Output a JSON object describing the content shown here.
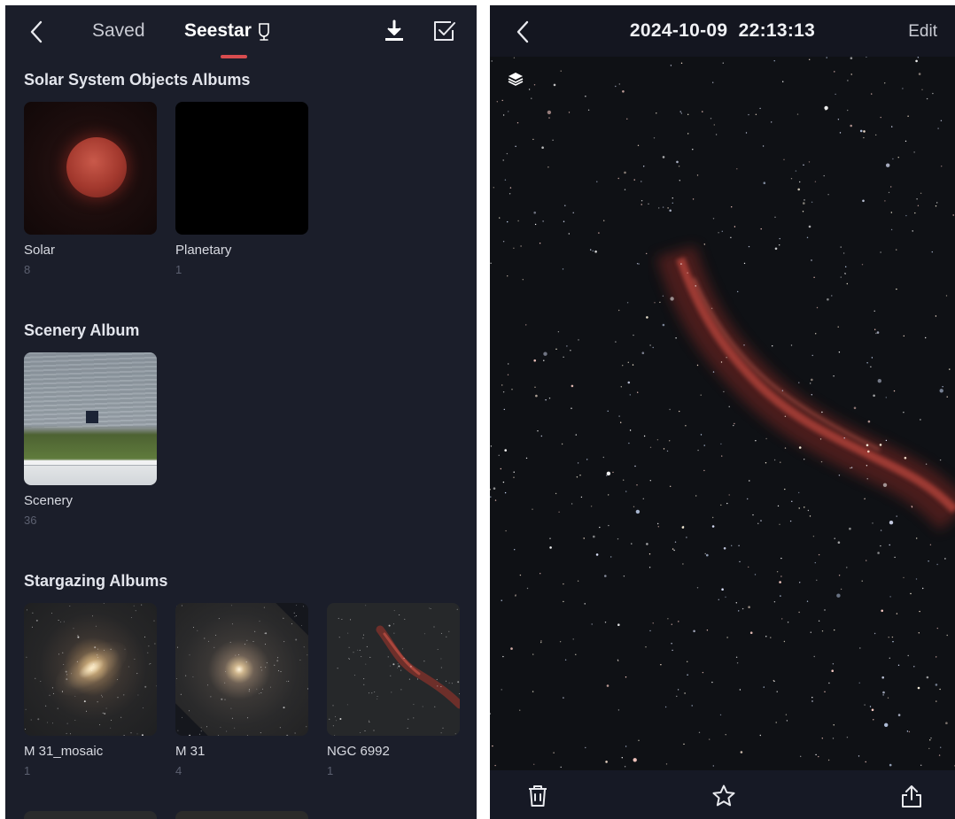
{
  "left": {
    "header": {
      "back_icon": "chevron-left-icon",
      "tab_saved": "Saved",
      "tab_seestar": "Seestar",
      "seestar_icon": "telescope-icon",
      "download_icon": "download-icon",
      "select_icon": "checkbox-select-icon",
      "active_color": "#d84c4f"
    },
    "sections": [
      {
        "title": "Solar System Objects Albums",
        "albums": [
          {
            "name": "Solar",
            "count": "8"
          },
          {
            "name": "Planetary",
            "count": "1"
          }
        ]
      },
      {
        "title": "Scenery Album",
        "albums": [
          {
            "name": "Scenery",
            "count": "36"
          }
        ]
      },
      {
        "title": "Stargazing Albums",
        "albums": [
          {
            "name": "M 31_mosaic",
            "count": "1"
          },
          {
            "name": "M 31",
            "count": "4"
          },
          {
            "name": "NGC 6992",
            "count": "1"
          }
        ]
      }
    ]
  },
  "right": {
    "header": {
      "back_icon": "chevron-left-icon",
      "title": "2024-10-09  22:13:13",
      "edit_label": "Edit"
    },
    "photo": {
      "overlay_icon": "stack-layers-icon"
    },
    "bottom_bar": {
      "delete_icon": "trash-icon",
      "favorite_icon": "star-icon",
      "share_icon": "share-icon"
    }
  }
}
